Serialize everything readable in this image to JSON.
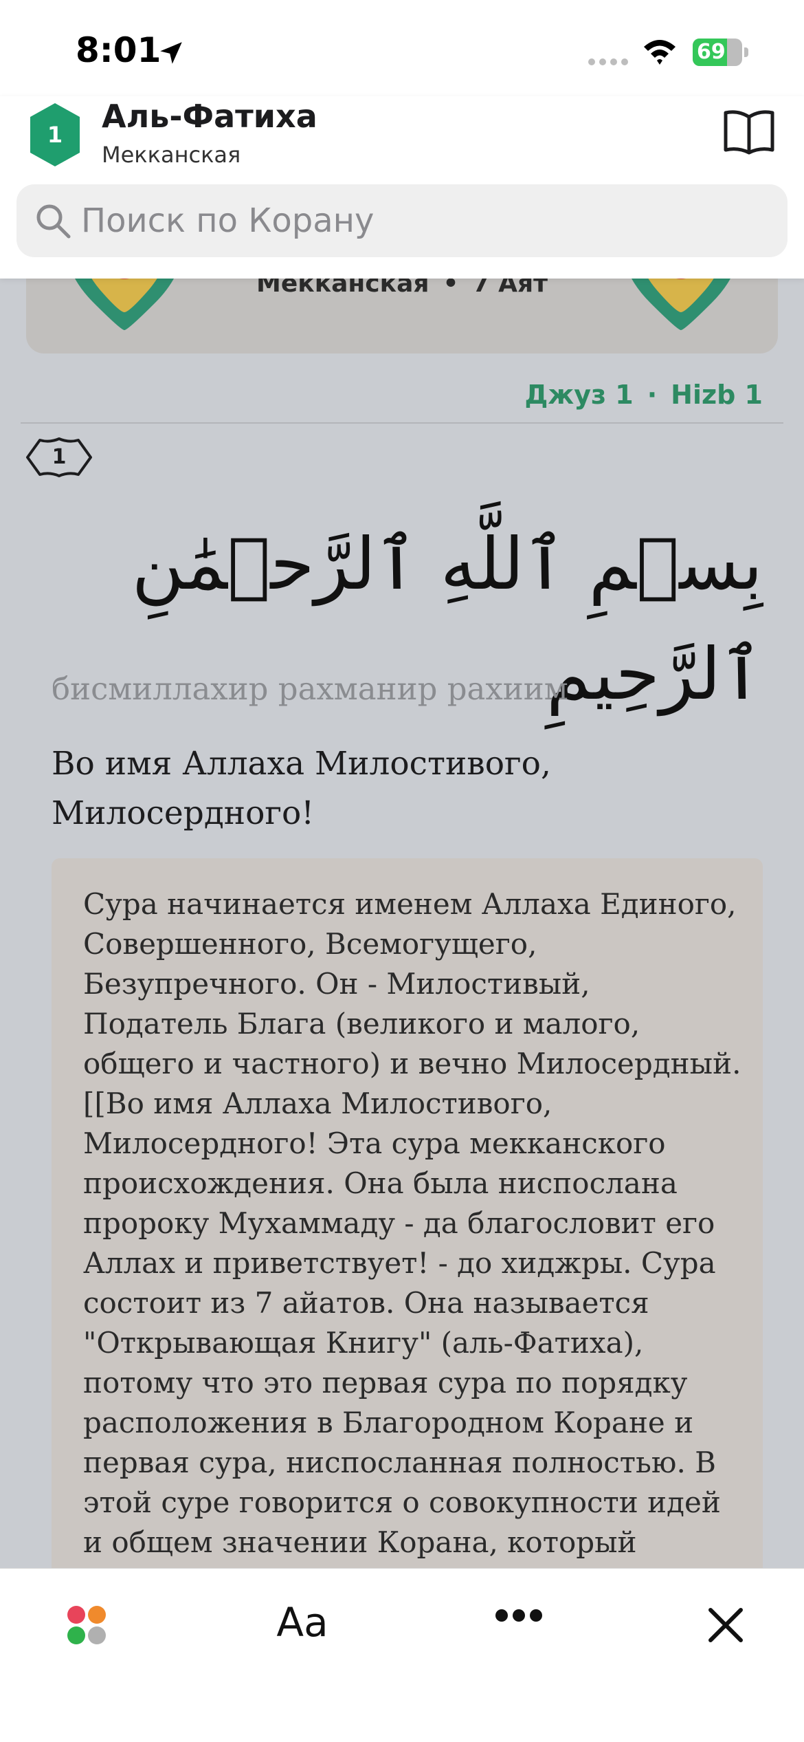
{
  "status_bar": {
    "time": "8:01",
    "battery_level": "69",
    "battery_percent": 69
  },
  "header": {
    "surah_number": "1",
    "surah_name": "Аль-Фатиха",
    "surah_type": "Мекканская"
  },
  "search": {
    "placeholder": "Поиск по Корану"
  },
  "banner": {
    "type": "Мекканская",
    "separator": "•",
    "ayah_count": "7 Аят"
  },
  "juz": {
    "juz_label": "Джуз 1",
    "separator": "·",
    "hizb_label": "Hizb 1"
  },
  "ayah": {
    "number": "1",
    "arabic": "بِسۡمِ ٱللَّهِ ٱلرَّحۡمَٰنِ ٱلرَّحِيمِ",
    "transliteration": "бисмиллахир рахманир рахиим",
    "translation": "Во имя Аллаха Милостивого, Милосердного!",
    "commentary": "Сура начинается именем Аллаха Единого, Совершенного, Всемогущего, Безупречного. Он - Милостивый, Податель Блага (великого и малого, общего и частного) и вечно Милосердный. [[Во имя Аллаха Милостивого, Милосердного! Эта сура мекканского происхождения. Она была ниспослана пророку Мухаммаду - да благословит его Аллах и приветствует! - до хиджры. Сура состоит из 7 айатов. Она называется \"Открывающая Книгу\" (аль-Фатиха), потому что это первая сура по порядку расположения в Благородном Коране и первая сура, ниспосланная полностью. В этой суре говорится о совокупности идей и общем значении Корана, который подтверждает единобожие,"
  },
  "toolbar": {
    "font_label": "Aa"
  },
  "colors": {
    "accent_green": "#1f9e6e",
    "juz_green": "#2d8a62",
    "tajweed_blue": "#2f6fb3",
    "tajweed_orange": "#d9822b",
    "palette_red": "#e8445a",
    "palette_orange": "#f08a2c",
    "palette_green": "#2fb24b",
    "palette_gray": "#b0b0b0"
  },
  "icons": {
    "location": "location-arrow-icon",
    "signal": "cellular-signal-icon",
    "wifi": "wifi-icon",
    "battery": "battery-charging-icon",
    "book": "book-open-icon",
    "search": "search-icon",
    "palette": "color-palette-icon",
    "more": "more-dots-icon",
    "close": "close-icon"
  }
}
